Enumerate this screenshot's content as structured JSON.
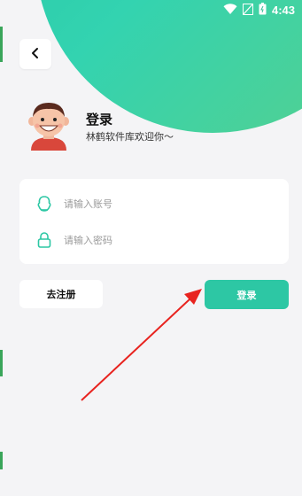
{
  "status_bar": {
    "time": "4:43",
    "icons": [
      "wifi-icon",
      "signal-muted-icon",
      "battery-icon"
    ]
  },
  "nav": {
    "back_icon": "chevron-left-icon"
  },
  "welcome": {
    "title": "登录",
    "subtitle": "林鹤软件库欢迎你～"
  },
  "form": {
    "account": {
      "placeholder": "请输入账号",
      "icon": "user-outline-icon"
    },
    "password": {
      "placeholder": "请输入密码",
      "icon": "lock-icon"
    }
  },
  "actions": {
    "register_label": "去注册",
    "login_label": "登录"
  },
  "colors": {
    "accent": "#2dc7a4",
    "background": "#f4f4f6",
    "annotation_arrow": "#e8231f"
  }
}
